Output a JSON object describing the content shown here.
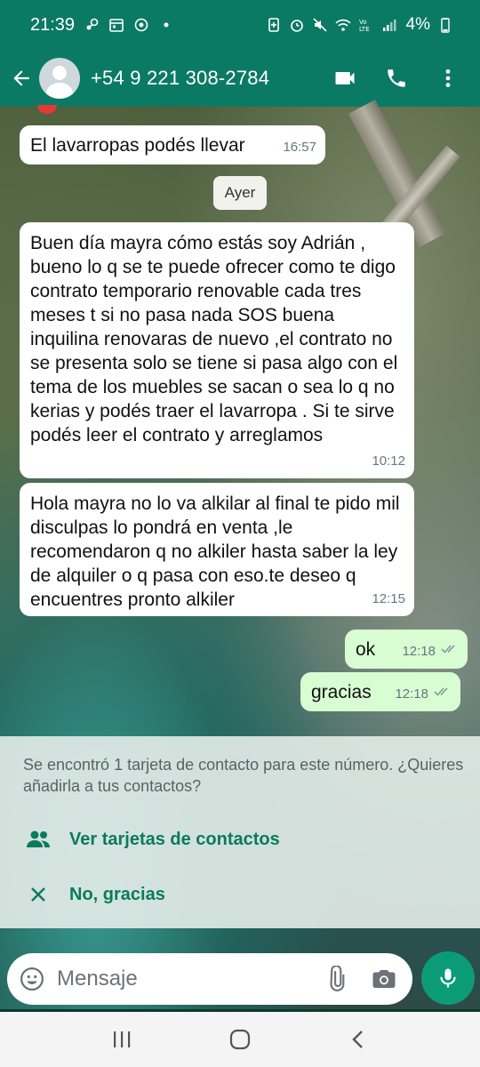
{
  "status_bar": {
    "time": "21:39",
    "battery": "4%",
    "icons": [
      "steam-notification-icon",
      "calendar-icon",
      "whatsapp-notification-icon",
      "dot-icon",
      "battery-saver-icon",
      "alarm-icon",
      "mute-icon",
      "wifi-icon",
      "volte-icon",
      "signal-icon",
      "battery-icon"
    ]
  },
  "header": {
    "contact_name": "+54 9 221 308-2784",
    "icons": [
      "back-arrow-icon",
      "avatar",
      "video-call-icon",
      "phone-icon",
      "more-vert-icon"
    ]
  },
  "messages": [
    {
      "direction": "in",
      "text": "El lavarropas podés llevar",
      "time": "16:57"
    },
    {
      "direction": "in",
      "text": "Buen día mayra cómo estás soy Adrián , bueno lo q se te puede ofrecer como te digo contrato temporario renovable cada tres meses t si no pasa nada SOS buena inquilina renovaras de nuevo ,el contrato no se presenta solo se tiene si pasa algo con el tema de los muebles se sacan o sea lo q no kerias y podés traer el lavarropa . Si te sirve podés leer el contrato y arreglamos",
      "time": "10:12"
    },
    {
      "direction": "in",
      "text": "Hola mayra no lo va alkilar al final te pido mil disculpas lo pondrá en venta ,le recomendaron q no alkiler hasta saber la ley de alquiler o q pasa con eso.te deseo q encuentres pronto alkiler",
      "time": "12:15"
    },
    {
      "direction": "out",
      "text": "ok",
      "time": "12:18",
      "status": "read"
    },
    {
      "direction": "out",
      "text": "gracias",
      "time": "12:18",
      "status": "read"
    }
  ],
  "date_divider": "Ayer",
  "contact_prompt": {
    "text": "Se encontró 1 tarjeta de contacto para este número. ¿Quieres añadirla a tus contactos?",
    "view_cards_label": "Ver tarjetas de contactos",
    "dismiss_label": "No, gracias"
  },
  "composer": {
    "placeholder": "Mensaje"
  },
  "colors": {
    "header": "#0b7a64",
    "incoming_bubble": "#ffffff",
    "outgoing_bubble": "#d9fdd3",
    "accent": "#0a7a5e",
    "mic_button": "#0b9c77"
  }
}
